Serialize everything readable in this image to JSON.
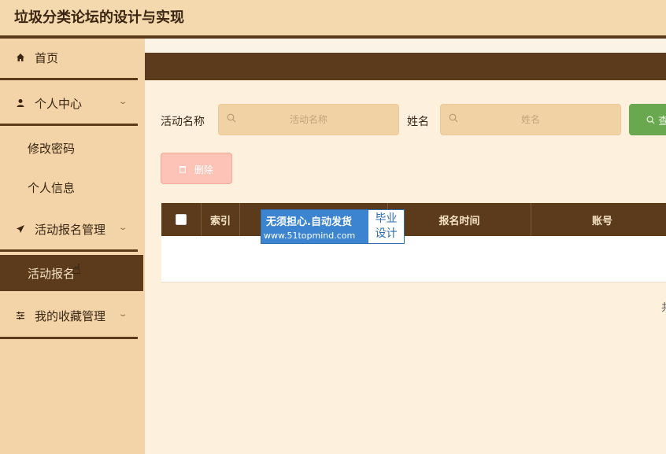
{
  "app": {
    "title": "垃圾分类论坛的设计与实现"
  },
  "sidebar": {
    "home": {
      "label": "首页",
      "icon": "home-icon"
    },
    "personal": {
      "label": "个人中心",
      "icon": "user-icon"
    },
    "change_password": {
      "label": "修改密码"
    },
    "personal_info": {
      "label": "个人信息"
    },
    "activity_mgmt": {
      "label": "活动报名管理",
      "icon": "send-icon"
    },
    "activity_signup": {
      "label": "活动报名"
    },
    "favorites": {
      "label": "我的收藏管理",
      "icon": "sliders-icon"
    }
  },
  "search": {
    "activity_label": "活动名称",
    "activity_placeholder": "活动名称",
    "name_label": "姓名",
    "name_placeholder": "姓名",
    "search_button": "查"
  },
  "actions": {
    "delete_button": "删除"
  },
  "table": {
    "columns": [
      "索引",
      "报名时间",
      "账号"
    ]
  },
  "pager": {
    "text": "共"
  },
  "watermark": {
    "line1": "无须担心.自动发货",
    "line2": "www.51topmind.com",
    "right1": "毕业",
    "right2": "设计"
  },
  "colors": {
    "accent_dark": "#5b3b1b",
    "sidebar_bg": "#f2d4a8",
    "search_green": "#6aa84f"
  }
}
